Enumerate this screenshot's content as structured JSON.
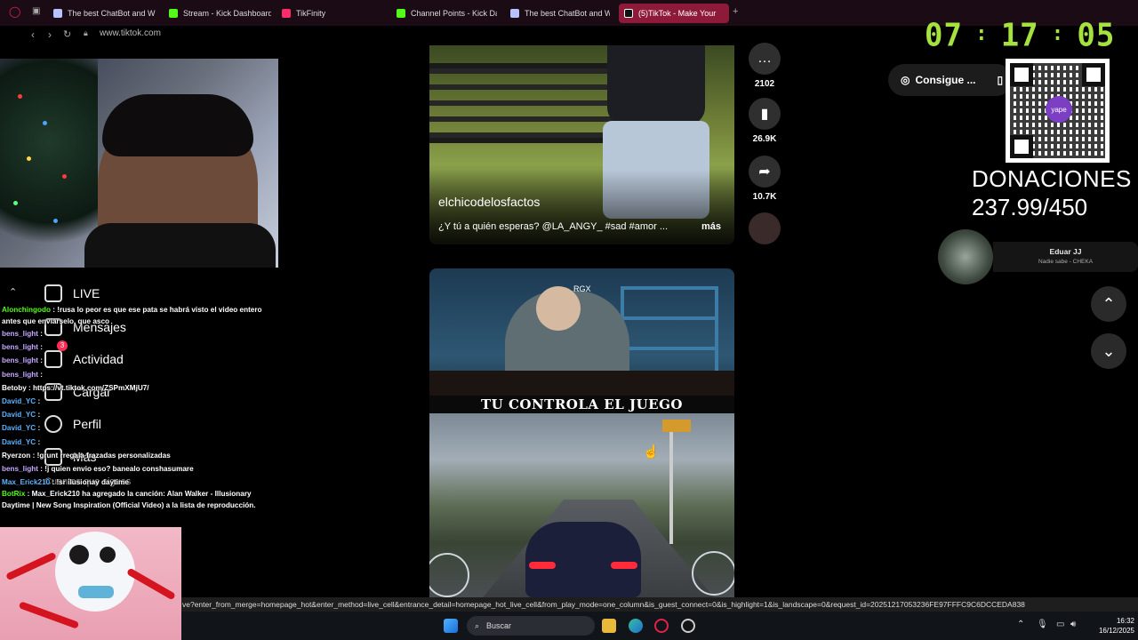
{
  "browser": {
    "tabs": [
      {
        "label": "The best ChatBot and Wi",
        "color": "#b7c2ff"
      },
      {
        "label": "Stream - Kick Dashboard",
        "color": "#53fc18"
      },
      {
        "label": "TikFinity",
        "color": "#ff2c6b"
      },
      {
        "label": "Channel Points - Kick Da",
        "color": "#53fc18"
      },
      {
        "label": "The best ChatBot and Wi",
        "color": "#b7c2ff"
      },
      {
        "label": "(5)TikTok - Make Your",
        "color": "#ffffff"
      }
    ],
    "new_tab": "+",
    "address": "www.tiktok.com"
  },
  "clock": {
    "hh": "07",
    "mm": "17",
    "ss": "05"
  },
  "tiktok_nav": {
    "items": [
      {
        "label": "LIVE",
        "icon": "live-tv-icon"
      },
      {
        "label": "Mensajes",
        "icon": "message-icon"
      },
      {
        "label": "Actividad",
        "icon": "inbox-icon",
        "badge": "3"
      },
      {
        "label": "Cargar",
        "icon": "upload-icon"
      },
      {
        "label": "Perfil",
        "icon": "profile-icon"
      },
      {
        "label": "Más",
        "icon": "more-icon"
      }
    ],
    "following_label": "Cuentas que sigues"
  },
  "chat": [
    {
      "user": "Alonchingodo",
      "color": "#53fc18",
      "text": " : !rusa lo peor es que ese pata se habrá visto el video entero antes que enviarselo, que asco",
      "wrap": true
    },
    {
      "user": "bens_light",
      "color": "#c7a8ff",
      "text": " :"
    },
    {
      "user": "bens_light",
      "color": "#c7a8ff",
      "text": " :"
    },
    {
      "user": "bens_light",
      "color": "#c7a8ff",
      "text": " :"
    },
    {
      "user": "bens_light",
      "color": "#c7a8ff",
      "text": " :"
    },
    {
      "user": "Betoby",
      "color": "#ffffff",
      "text": " : https://vt.tiktok.com/ZSPmXMjU7/"
    },
    {
      "user": "David_YC",
      "color": "#5ab4ff",
      "text": " :"
    },
    {
      "user": "David_YC",
      "color": "#5ab4ff",
      "text": " :"
    },
    {
      "user": "David_YC",
      "color": "#5ab4ff",
      "text": " :"
    },
    {
      "user": "David_YC",
      "color": "#5ab4ff",
      "text": " :"
    },
    {
      "user": "Ryerzon",
      "color": "#ffffff",
      "text": " : !grunt rregala frazadas personalizadas"
    },
    {
      "user": "bens_light",
      "color": "#c7a8ff",
      "text": " : !j quien envio eso? banealo conshasumare"
    },
    {
      "user": "Max_Erick210",
      "color": "#5ab4ff",
      "text": " : !sr ilusionay daytime"
    },
    {
      "user": "BotRix",
      "color": "#53fc18",
      "text": " : Max_Erick210 ha agregado la canción: Alan Walker - Illusionary Daytime | New Song Inspiration (Official Video) a la lista de reproducción.",
      "wrap": true
    }
  ],
  "videos": [
    {
      "author": "elchicodelosfactos",
      "desc": "¿Y tú a quién esperas? @LA_ANGY_ #sad #amor ...",
      "more": "más"
    },
    {
      "watermark": "RGX",
      "banner": "TU CONTROLA EL JUEGO"
    }
  ],
  "actions": [
    {
      "icon": "comment-icon",
      "count": "2102"
    },
    {
      "icon": "bookmark-icon",
      "count": "26.9K"
    },
    {
      "icon": "share-icon",
      "count": "10.7K"
    }
  ],
  "right": {
    "consigue_label": "Consigue ...",
    "qr_logo": "yape",
    "donations_label": "DONACIONES",
    "donations_value": "237.99/450",
    "now_playing_artist": "Eduar JJ",
    "now_playing_song": "Nadie sabe - CHEKA"
  },
  "status_url": "ve?enter_from_merge=homepage_hot&enter_method=live_cell&entrance_detail=homepage_hot_live_cell&from_play_mode=one_column&is_guest_connect=0&is_highlight=1&is_landscape=0&request_id=20251217053236FE97FFFC9C6DCCEDA838",
  "taskbar": {
    "search_placeholder": "Buscar",
    "time": "16:32",
    "date": "16/12/2025"
  }
}
